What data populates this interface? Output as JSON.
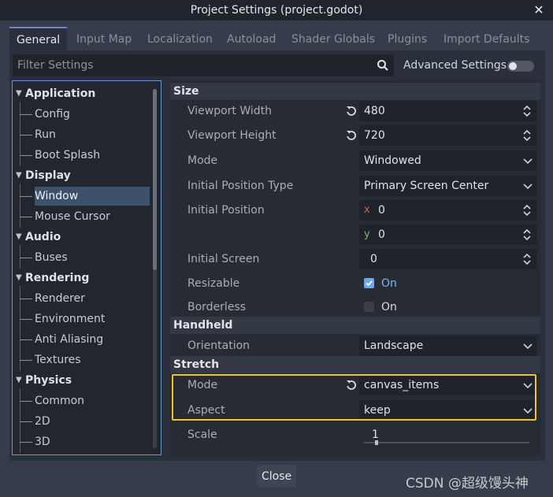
{
  "window": {
    "title": "Project Settings (project.godot)"
  },
  "tabs": [
    "General",
    "Input Map",
    "Localization",
    "Autoload",
    "Shader Globals",
    "Plugins",
    "Import Defaults"
  ],
  "filter": {
    "placeholder": "Filter Settings"
  },
  "advanced": {
    "label": "Advanced Settings",
    "enabled": false
  },
  "tree": {
    "sections": [
      {
        "label": "Application",
        "items": [
          "Config",
          "Run",
          "Boot Splash"
        ]
      },
      {
        "label": "Display",
        "items": [
          "Window",
          "Mouse Cursor"
        ],
        "selected": "Window"
      },
      {
        "label": "Audio",
        "items": [
          "Buses"
        ]
      },
      {
        "label": "Rendering",
        "items": [
          "Renderer",
          "Environment",
          "Anti Aliasing",
          "Textures"
        ]
      },
      {
        "label": "Physics",
        "items": [
          "Common",
          "2D",
          "3D"
        ]
      }
    ]
  },
  "props": {
    "size_section": "Size",
    "viewport_width": {
      "label": "Viewport Width",
      "value": "480"
    },
    "viewport_height": {
      "label": "Viewport Height",
      "value": "720"
    },
    "mode": {
      "label": "Mode",
      "value": "Windowed"
    },
    "initial_position_type": {
      "label": "Initial Position Type",
      "value": "Primary Screen Center"
    },
    "initial_position": {
      "label": "Initial Position",
      "x_axis": "x",
      "x": "0",
      "y_axis": "y",
      "y": "0"
    },
    "initial_screen": {
      "label": "Initial Screen",
      "value": "0"
    },
    "resizable": {
      "label": "Resizable",
      "value": "On",
      "checked": true
    },
    "borderless": {
      "label": "Borderless",
      "value": "On",
      "checked": false
    },
    "handheld_section": "Handheld",
    "orientation": {
      "label": "Orientation",
      "value": "Landscape"
    },
    "stretch_section": "Stretch",
    "stretch_mode": {
      "label": "Mode",
      "value": "canvas_items"
    },
    "stretch_aspect": {
      "label": "Aspect",
      "value": "keep"
    },
    "stretch_scale": {
      "label": "Scale",
      "value": "1"
    }
  },
  "footer": {
    "close_label": "Close"
  },
  "watermark": "CSDN @超级馒头神",
  "colors": {
    "accent": "#6a93d8",
    "highlight": "#f2c524",
    "axis_x": "#c4655f",
    "axis_y": "#7fb26a"
  }
}
